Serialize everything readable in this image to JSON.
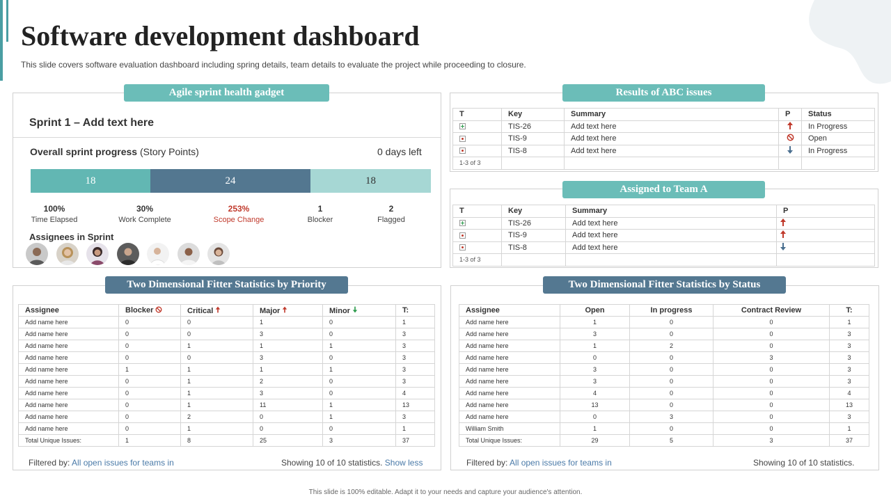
{
  "header": {
    "title": "Software development dashboard",
    "subtitle": "This slide covers software evaluation dashboard including spring details, team details to evaluate the project while proceeding to closure."
  },
  "footer": "This slide is 100% editable. Adapt it to your needs and capture your audience's attention.",
  "sprint_panel": {
    "pill": "Agile sprint health gadget",
    "sprint_title": "Sprint 1 – Add text here",
    "progress_label_bold": "Overall sprint progress",
    "progress_label_rest": " (Story Points)",
    "days_left": "0 days left",
    "bars": [
      {
        "value": "18",
        "color": "#62b7b3"
      },
      {
        "value": "24",
        "color": "#537790"
      },
      {
        "value": "18",
        "color": "#a6d7d4"
      }
    ],
    "stats": [
      {
        "value": "100%",
        "label": "Time Elapsed"
      },
      {
        "value": "30%",
        "label": "Work Complete"
      },
      {
        "value": "253%",
        "label": "Scope Change"
      },
      {
        "value": "1",
        "label": "Blocker"
      },
      {
        "value": "2",
        "label": "Flagged"
      }
    ],
    "assignees_label": "Assignees  in Sprint"
  },
  "abc_issues": {
    "pill": "Results of  ABC issues",
    "headers": [
      "T",
      "Key",
      "Summary",
      "P",
      "Status"
    ],
    "rows": [
      {
        "type": "plus-icon",
        "key": "TIS-26",
        "summary": "Add text here",
        "priority": "up-arrow-icon",
        "status": "In Progress"
      },
      {
        "type": "bug-icon",
        "key": "TIS-9",
        "summary": "Add text here",
        "priority": "blocked-icon",
        "status": "Open"
      },
      {
        "type": "bug-icon",
        "key": "TIS-8",
        "summary": "Add text here",
        "priority": "down-arrow-icon",
        "status": "In Progress"
      }
    ],
    "count": "1-3 of 3"
  },
  "team_a": {
    "pill": "Assigned to Team A",
    "headers": [
      "T",
      "Key",
      "Summary",
      "P"
    ],
    "rows": [
      {
        "type": "plus-icon",
        "key": "TIS-26",
        "summary": "Add text here",
        "priority": "up-arrow-icon"
      },
      {
        "type": "bug-icon",
        "key": "TIS-9",
        "summary": "Add text here",
        "priority": "up-arrow-icon"
      },
      {
        "type": "bug-icon",
        "key": "TIS-8",
        "summary": "Add text here",
        "priority": "down-arrow-icon"
      }
    ],
    "count": "1-3 of 3"
  },
  "priority_stats": {
    "pill": "Two Dimensional Fitter Statistics by Priority",
    "headers": [
      "Assignee",
      "Blocker",
      "Critical",
      "Major",
      "Minor",
      "T:"
    ],
    "rows": [
      [
        "Add name here",
        "0",
        "0",
        "1",
        "0",
        "1"
      ],
      [
        "Add name here",
        "0",
        "0",
        "3",
        "0",
        "3"
      ],
      [
        "Add name here",
        "0",
        "1",
        "1",
        "1",
        "3"
      ],
      [
        "Add name here",
        "0",
        "0",
        "3",
        "0",
        "3"
      ],
      [
        "Add name here",
        "1",
        "1",
        "1",
        "1",
        "3"
      ],
      [
        "Add name here",
        "0",
        "1",
        "2",
        "0",
        "3"
      ],
      [
        "Add name here",
        "0",
        "1",
        "3",
        "0",
        "4"
      ],
      [
        "Add name here",
        "0",
        "1",
        "11",
        "1",
        "13"
      ],
      [
        "Add name here",
        "0",
        "2",
        "0",
        "1",
        "3"
      ],
      [
        "Add name here",
        "0",
        "1",
        "0",
        "0",
        "1"
      ],
      [
        "Total Unique Issues:",
        "1",
        "8",
        "25",
        "3",
        "37"
      ]
    ],
    "filtered_label": "Filtered by:",
    "filtered_link": "All open issues for teams in",
    "showing": "Showing 10 of 10 statistics.",
    "show_less": "Show less"
  },
  "status_stats": {
    "pill": "Two Dimensional Fitter Statistics by Status",
    "headers": [
      "Assignee",
      "Open",
      "In progress",
      "Contract Review",
      "T:"
    ],
    "rows": [
      [
        "Add name here",
        "1",
        "0",
        "0",
        "1"
      ],
      [
        "Add name here",
        "3",
        "0",
        "0",
        "3"
      ],
      [
        "Add name here",
        "1",
        "2",
        "0",
        "3"
      ],
      [
        "Add name here",
        "0",
        "0",
        "3",
        "3"
      ],
      [
        "Add name here",
        "3",
        "0",
        "0",
        "3"
      ],
      [
        "Add name here",
        "3",
        "0",
        "0",
        "3"
      ],
      [
        "Add name here",
        "4",
        "0",
        "0",
        "4"
      ],
      [
        "Add name here",
        "13",
        "0",
        "0",
        "13"
      ],
      [
        "Add name here",
        "0",
        "3",
        "0",
        "3"
      ],
      [
        "William Smith",
        "1",
        "0",
        "0",
        "1"
      ],
      [
        "Total Unique Issues:",
        "29",
        "5",
        "3",
        "37"
      ]
    ],
    "filtered_label": "Filtered by:",
    "filtered_link": "All open issues for teams in",
    "showing": "Showing 10 of 10 statistics."
  },
  "colors": {
    "teal": "#6bbdb8",
    "slate": "#547891",
    "red": "#c0392b",
    "green": "#2a9a4a",
    "arrow_blue": "#4a6f8f"
  }
}
